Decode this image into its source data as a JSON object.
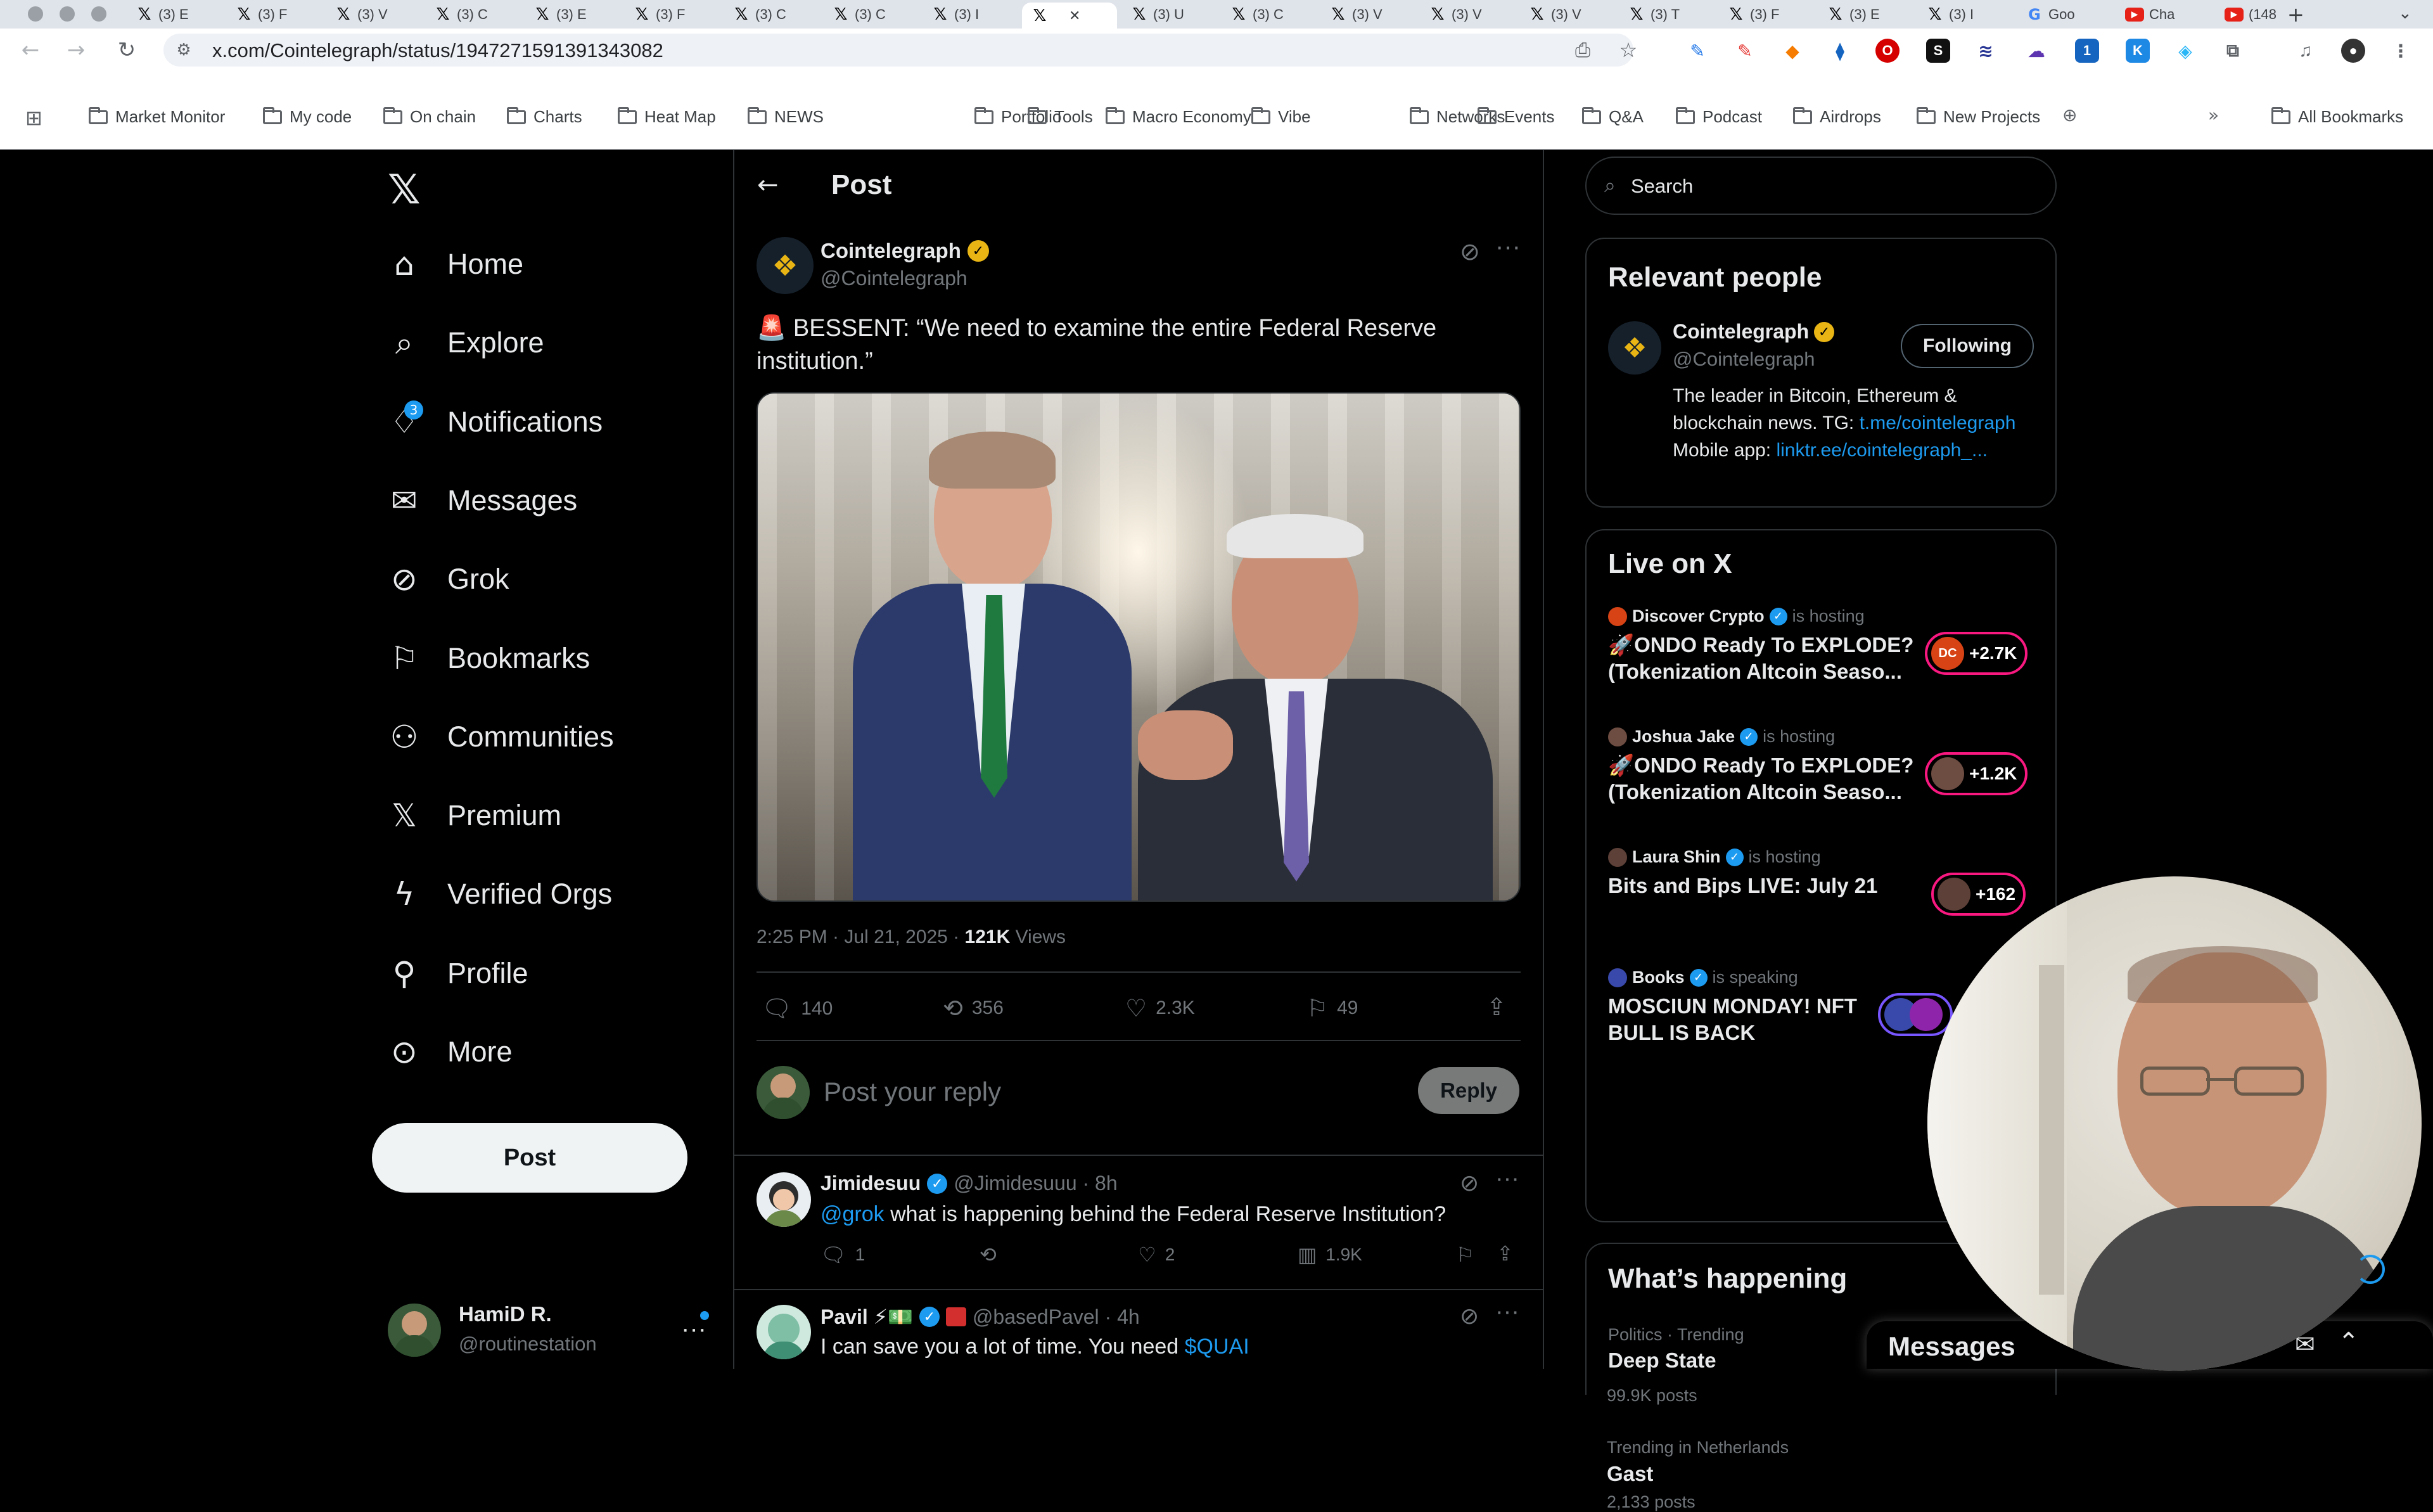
{
  "browser": {
    "tabs": [
      {
        "label": "(3) E",
        "icon": "x-icon"
      },
      {
        "label": "(3) F",
        "icon": "x-icon"
      },
      {
        "label": "(3) V",
        "icon": "x-icon"
      },
      {
        "label": "(3) C",
        "icon": "x-icon"
      },
      {
        "label": "(3) E",
        "icon": "x-icon"
      },
      {
        "label": "(3) F",
        "icon": "x-icon"
      },
      {
        "label": "(3) C",
        "icon": "x-icon"
      },
      {
        "label": "(3) C",
        "icon": "x-icon"
      },
      {
        "label": "(3) I",
        "icon": "x-icon"
      },
      {
        "label": "",
        "icon": "x-icon",
        "active": true
      },
      {
        "label": "(3) U",
        "icon": "x-icon"
      },
      {
        "label": "(3) C",
        "icon": "x-icon"
      },
      {
        "label": "(3) V",
        "icon": "x-icon"
      },
      {
        "label": "(3) V",
        "icon": "x-icon"
      },
      {
        "label": "(3) V",
        "icon": "x-icon"
      },
      {
        "label": "(3) T",
        "icon": "x-icon"
      },
      {
        "label": "(3) F",
        "icon": "x-icon"
      },
      {
        "label": "(3) E",
        "icon": "x-icon"
      },
      {
        "label": "(3) I",
        "icon": "x-icon"
      },
      {
        "label": "Goo",
        "icon": "google-icon"
      },
      {
        "label": "Cha",
        "icon": "youtube-icon"
      },
      {
        "label": "(148",
        "icon": "youtube-icon"
      }
    ],
    "url": "x.com/Cointelegraph/status/1947271591391343082",
    "bookmarks": [
      "Market Monitor",
      "My code",
      "On chain",
      "Charts",
      "Heat Map",
      "NEWS",
      "Portfolio",
      "Tools",
      "Macro Economy",
      "Vibe",
      "Networks",
      "Events",
      "Q&A",
      "Podcast",
      "Airdrops",
      "New Projects"
    ],
    "all_bookmarks": "All Bookmarks"
  },
  "nav": {
    "items": [
      {
        "label": "Home",
        "icon": "home-icon"
      },
      {
        "label": "Explore",
        "icon": "search-icon"
      },
      {
        "label": "Notifications",
        "icon": "bell-icon",
        "badge": "3"
      },
      {
        "label": "Messages",
        "icon": "envelope-icon"
      },
      {
        "label": "Grok",
        "icon": "grok-icon"
      },
      {
        "label": "Bookmarks",
        "icon": "bookmark-icon"
      },
      {
        "label": "Communities",
        "icon": "communities-icon"
      },
      {
        "label": "Premium",
        "icon": "x-premium-icon"
      },
      {
        "label": "Verified Orgs",
        "icon": "lightning-icon"
      },
      {
        "label": "Profile",
        "icon": "person-icon"
      },
      {
        "label": "More",
        "icon": "more-circle-icon"
      }
    ],
    "post_button": "Post",
    "account": {
      "name": "HamiD R.",
      "handle": "@routinestation"
    }
  },
  "main": {
    "header_title": "Post",
    "post": {
      "author": "Cointelegraph",
      "handle": "@Cointelegraph",
      "text": "🚨 BESSENT: “We need to examine the entire Federal Reserve institution.”",
      "time": "2:25 PM · Jul 21, 2025 · ",
      "views_count": "121K",
      "views_label": " Views",
      "replies": "140",
      "reposts": "356",
      "likes": "2.3K",
      "bookmarks": "49"
    },
    "reply_placeholder": "Post your reply",
    "reply_button": "Reply",
    "replies": [
      {
        "name": "Jimidesuu",
        "handle": "@Jimidesuuu · 8h",
        "mention": "@grok",
        "text": " what is happening behind the Federal Reserve Institution?",
        "replies": "1",
        "likes": "2",
        "views": "1.9K"
      },
      {
        "name": "Pavil ⚡💵",
        "handle": "@basedPavel · 4h",
        "text": "I can save you a lot of time. You need ",
        "ticker": "$QUAI"
      }
    ]
  },
  "sidebar": {
    "search_placeholder": "Search",
    "relevant_title": "Relevant people",
    "person": {
      "name": "Cointelegraph",
      "handle": "@Cointelegraph",
      "follow_label": "Following",
      "bio": "The leader in Bitcoin, Ethereum & blockchain news. TG:",
      "link1": "t.me/cointelegraph",
      "bio2": " Mobile app:",
      "link2": "linktr.ee/cointelegraph_..."
    },
    "live_title": "Live on X",
    "live": [
      {
        "host": "Discover Crypto",
        "status": "is hosting",
        "title1": "🚀ONDO Ready To EXPLODE?",
        "title2": "(Tokenization Altcoin Seaso...",
        "count": "+2.7K",
        "pill": "DC"
      },
      {
        "host": "Joshua Jake",
        "status": "is hosting",
        "title1": "🚀ONDO Ready To EXPLODE?",
        "title2": "(Tokenization Altcoin Seaso...",
        "count": "+1.2K",
        "pill": ""
      },
      {
        "host": "Laura Shin",
        "status": "is hosting",
        "title1": "Bits and Bips LIVE: July 21",
        "title2": "",
        "count": "+162",
        "pill": ""
      },
      {
        "host": "Books",
        "status": "is speaking",
        "title1": "MOSCIUN MONDAY! NFT",
        "title2": "BULL IS BACK",
        "count": "",
        "pill": ""
      }
    ],
    "happening_title": "What’s happening",
    "trends": [
      {
        "context": "Politics · Trending",
        "name": "Deep State",
        "posts": "99.9K posts"
      },
      {
        "context": "Trending in Netherlands",
        "name": "Gast",
        "posts": "2,133 posts"
      }
    ],
    "messages_drawer": "Messages"
  },
  "colors": {
    "accent": "#1d9bf0",
    "gold": "#e8b515",
    "live": "#f91880",
    "bg": "#000000",
    "border": "#2f3336"
  }
}
